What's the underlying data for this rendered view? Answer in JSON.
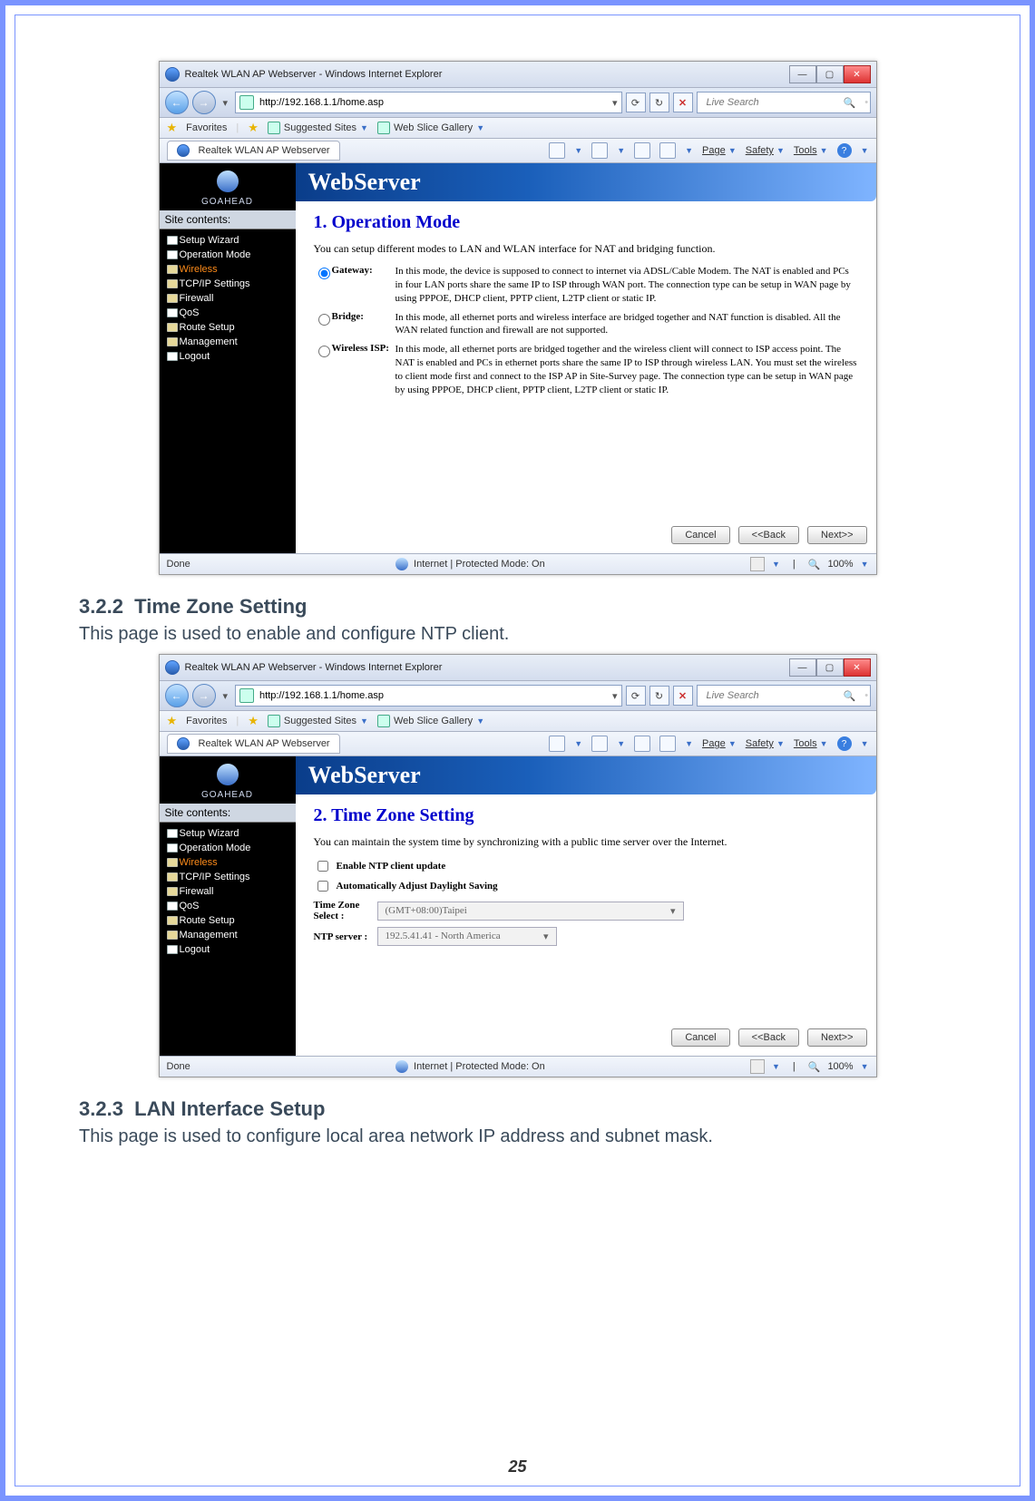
{
  "page_number": "25",
  "section_a": {
    "num": "3.2.2",
    "title": "Time Zone Setting",
    "desc": "This page is used to enable and configure NTP client."
  },
  "section_b": {
    "num": "3.2.3",
    "title": "LAN Interface Setup",
    "desc": "This page is used to configure local area network IP address and subnet mask."
  },
  "browser": {
    "window_title": "Realtek WLAN AP Webserver - Windows Internet Explorer",
    "url": "http://192.168.1.1/home.asp",
    "search_placeholder": "Live Search",
    "fav_label": "Favorites",
    "suggested": "Suggested Sites",
    "webslice": "Web Slice Gallery",
    "tab_label": "Realtek WLAN AP Webserver",
    "cmd_page": "Page",
    "cmd_safety": "Safety",
    "cmd_tools": "Tools",
    "status_done": "Done",
    "status_zone": "Internet | Protected Mode: On",
    "zoom": "100%"
  },
  "webserver": {
    "logo_text": "GOAHEAD",
    "banner": "WebServer",
    "site_head": "Site contents:",
    "menu": [
      {
        "label": "Setup Wizard",
        "doc": true
      },
      {
        "label": "Operation Mode",
        "doc": true
      },
      {
        "label": "Wireless",
        "sel": true
      },
      {
        "label": "TCP/IP Settings"
      },
      {
        "label": "Firewall"
      },
      {
        "label": "QoS",
        "doc": true
      },
      {
        "label": "Route Setup"
      },
      {
        "label": "Management"
      },
      {
        "label": "Logout",
        "doc": true
      }
    ]
  },
  "shot1": {
    "title": "1. Operation Mode",
    "intro": "You can setup different modes to LAN and WLAN interface for NAT and bridging function.",
    "modes": [
      {
        "name": "Gateway:",
        "checked": true,
        "desc": "In this mode, the device is supposed to connect to internet via ADSL/Cable Modem. The NAT is enabled and PCs in four LAN ports share the same IP to ISP through WAN port. The connection type can be setup in WAN page by using PPPOE, DHCP client, PPTP client, L2TP client or static IP."
      },
      {
        "name": "Bridge:",
        "checked": false,
        "desc": "In this mode, all ethernet ports and wireless interface are bridged together and NAT function is disabled. All the WAN related function and firewall are not supported."
      },
      {
        "name": "Wireless ISP:",
        "checked": false,
        "desc": "In this mode, all ethernet ports are bridged together and the wireless client will connect to ISP access point. The NAT is enabled and PCs in ethernet ports share the same IP to ISP through wireless LAN. You must set the wireless to client mode first and connect to the ISP AP in Site-Survey page. The connection type can be setup in WAN page by using PPPOE, DHCP client, PPTP client, L2TP client or static IP."
      }
    ],
    "btn_cancel": "Cancel",
    "btn_back": "<<Back",
    "btn_next": "Next>>"
  },
  "shot2": {
    "title": "2. Time Zone Setting",
    "intro": "You can maintain the system time by synchronizing with a public time server over the Internet.",
    "chk_ntp": "Enable NTP client update",
    "chk_dst": "Automatically Adjust Daylight Saving",
    "tz_label": "Time Zone Select :",
    "tz_value": "(GMT+08:00)Taipei",
    "ntp_label": "NTP server :",
    "ntp_value": "192.5.41.41 - North America",
    "btn_cancel": "Cancel",
    "btn_back": "<<Back",
    "btn_next": "Next>>"
  }
}
